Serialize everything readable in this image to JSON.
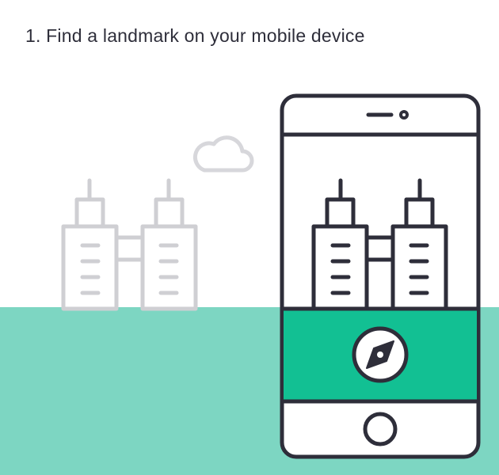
{
  "step": {
    "title": "1. Find a landmark on your mobile device"
  },
  "icons": {
    "cloud": "cloud-icon",
    "buildings": "twin-towers-icon",
    "phone": "smartphone-icon",
    "compass": "compass-icon",
    "home_button": "home-button-icon"
  },
  "colors": {
    "background": "#ffffff",
    "ground": "#7dd6c2",
    "phone_screen_band": "#12c093",
    "phone_outline": "#2e2e3a",
    "faded_building": "#cfcfd3",
    "title_text": "#2e2e3a"
  }
}
